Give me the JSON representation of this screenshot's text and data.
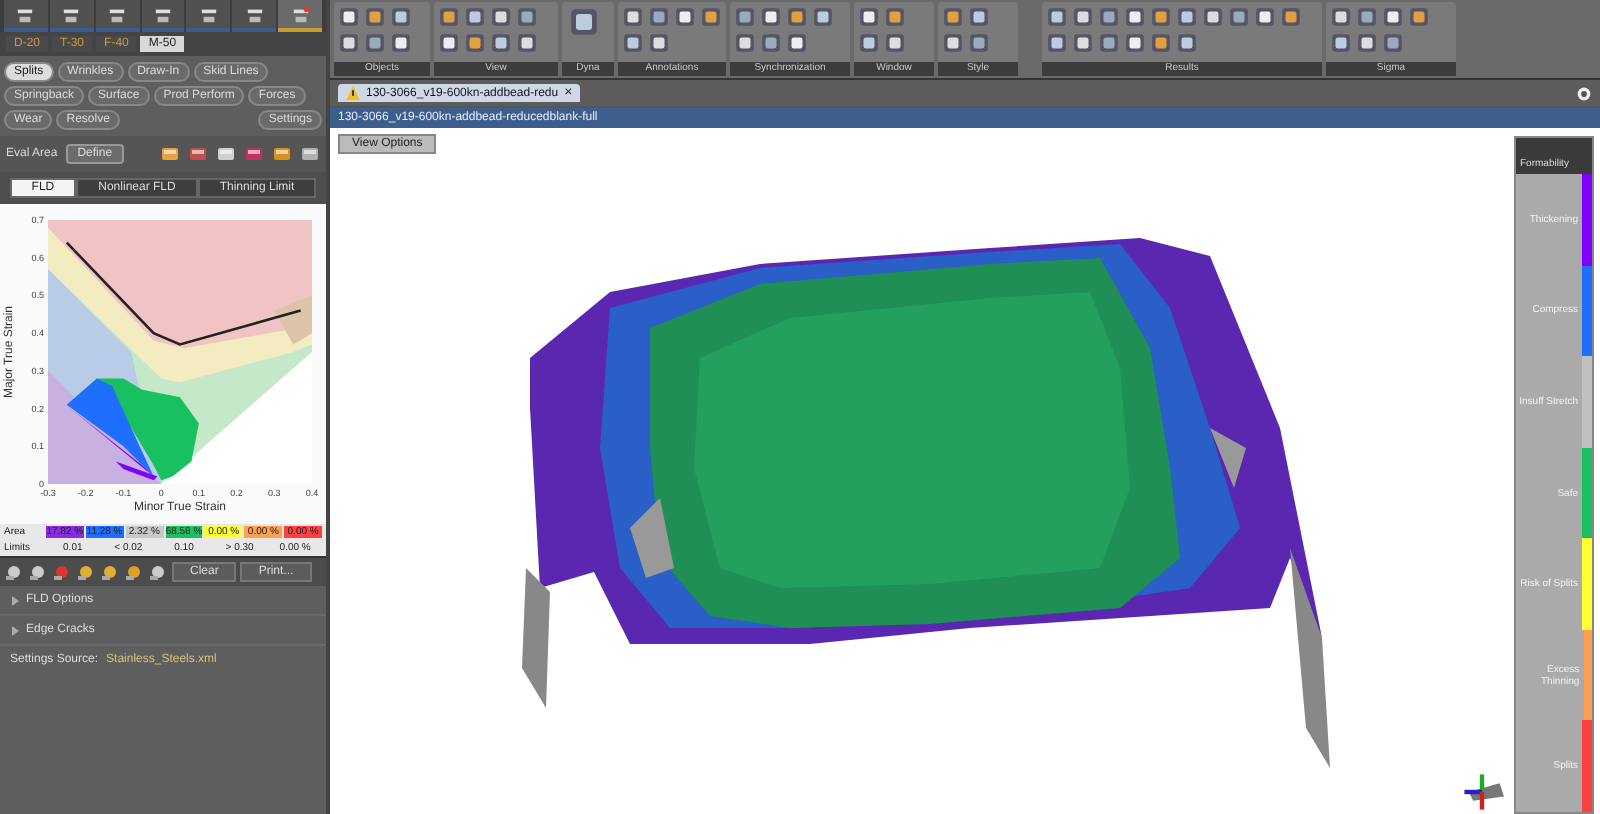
{
  "left_panel": {
    "stage_tabs": [
      {
        "label": "D-20",
        "selected": false
      },
      {
        "label": "T-30",
        "selected": false
      },
      {
        "label": "F-40",
        "selected": false
      },
      {
        "label": "M-50",
        "selected": true
      }
    ],
    "mode_buttons": [
      {
        "label": "Splits",
        "selected": true
      },
      {
        "label": "Wrinkles",
        "selected": false
      },
      {
        "label": "Draw-In",
        "selected": false
      },
      {
        "label": "Skid Lines",
        "selected": false
      },
      {
        "label": "Springback",
        "selected": false
      },
      {
        "label": "Surface",
        "selected": false
      },
      {
        "label": "Prod Perform",
        "selected": false
      },
      {
        "label": "Forces",
        "selected": false
      },
      {
        "label": "Wear",
        "selected": false
      },
      {
        "label": "Resolve",
        "selected": false
      }
    ],
    "settings_button": "Settings",
    "eval_area": {
      "label": "Eval Area",
      "value": "Define"
    },
    "fld_tabs": [
      {
        "label": "FLD",
        "selected": true
      },
      {
        "label": "Nonlinear FLD",
        "selected": false
      },
      {
        "label": "Thinning Limit",
        "selected": false
      }
    ],
    "fld_chart": {
      "chart_data": {
        "type": "line",
        "xlabel": "Minor True Strain",
        "ylabel": "Major True Strain",
        "x": [
          -0.25,
          -0.02,
          0.05,
          0.37
        ],
        "series": [
          {
            "color": "#222222",
            "values": [
              0.64,
              0.4,
              0.37,
              0.46
            ]
          }
        ],
        "xlim": [
          -0.3,
          0.4
        ],
        "ylim": [
          0,
          0.7
        ],
        "xticks": [
          -0.3,
          -0.2,
          -0.1,
          0,
          0.1,
          0.2,
          0.3,
          0.4
        ],
        "yticks": [
          0,
          0.1,
          0.2,
          0.3,
          0.4,
          0.5,
          0.6,
          0.7
        ]
      }
    },
    "area_label": "Area",
    "limits_label": "Limits",
    "zones": [
      {
        "area": "17.82 %",
        "color": "#8a2be2"
      },
      {
        "area": "11.28 %",
        "color": "#1e6fff"
      },
      {
        "area": "2.32 %",
        "color": "#c8c8c8"
      },
      {
        "area": "68.58 %",
        "color": "#19c060"
      },
      {
        "area": "0.00 %",
        "color": "#ffff30"
      },
      {
        "area": "0.00 %",
        "color": "#ffa050"
      },
      {
        "area": "0.00 %",
        "color": "#ff4040"
      }
    ],
    "limits": [
      "0.01",
      "< 0.02",
      "0.10",
      "> 0.30",
      "0.00 %"
    ],
    "clear_button": "Clear",
    "print_button": "Print...",
    "sections": [
      {
        "label": "FLD Options",
        "expanded": false
      },
      {
        "label": "Edge Cracks",
        "expanded": false
      }
    ],
    "settings_source": {
      "label": "Settings Source:",
      "value": "Stainless_Steels.xml"
    }
  },
  "ribbon": {
    "groups": [
      "Objects",
      "View",
      "Dyna",
      "Annotations",
      "Synchronization",
      "Window",
      "Style",
      "Results",
      "Sigma"
    ]
  },
  "document_tab": {
    "label": "130-3066_v19-600kn-addbead-redu",
    "close": "×"
  },
  "view": {
    "title": "130-3066_v19-600kn-addbead-reducedblank-full",
    "view_options": "View Options",
    "legend": {
      "title": "Formability",
      "items": [
        {
          "label": "Thickening",
          "color": "#8000ff"
        },
        {
          "label": "Compress",
          "color": "#1e6fff"
        },
        {
          "label": "Insuff Stretch",
          "color": "#c0c0c0"
        },
        {
          "label": "Safe",
          "color": "#19c060"
        },
        {
          "label": "Risk of Splits",
          "color": "#ffff30"
        },
        {
          "label": "Excess Thinning",
          "color": "#ffa050"
        },
        {
          "label": "Splits",
          "color": "#ff4040"
        }
      ]
    }
  }
}
